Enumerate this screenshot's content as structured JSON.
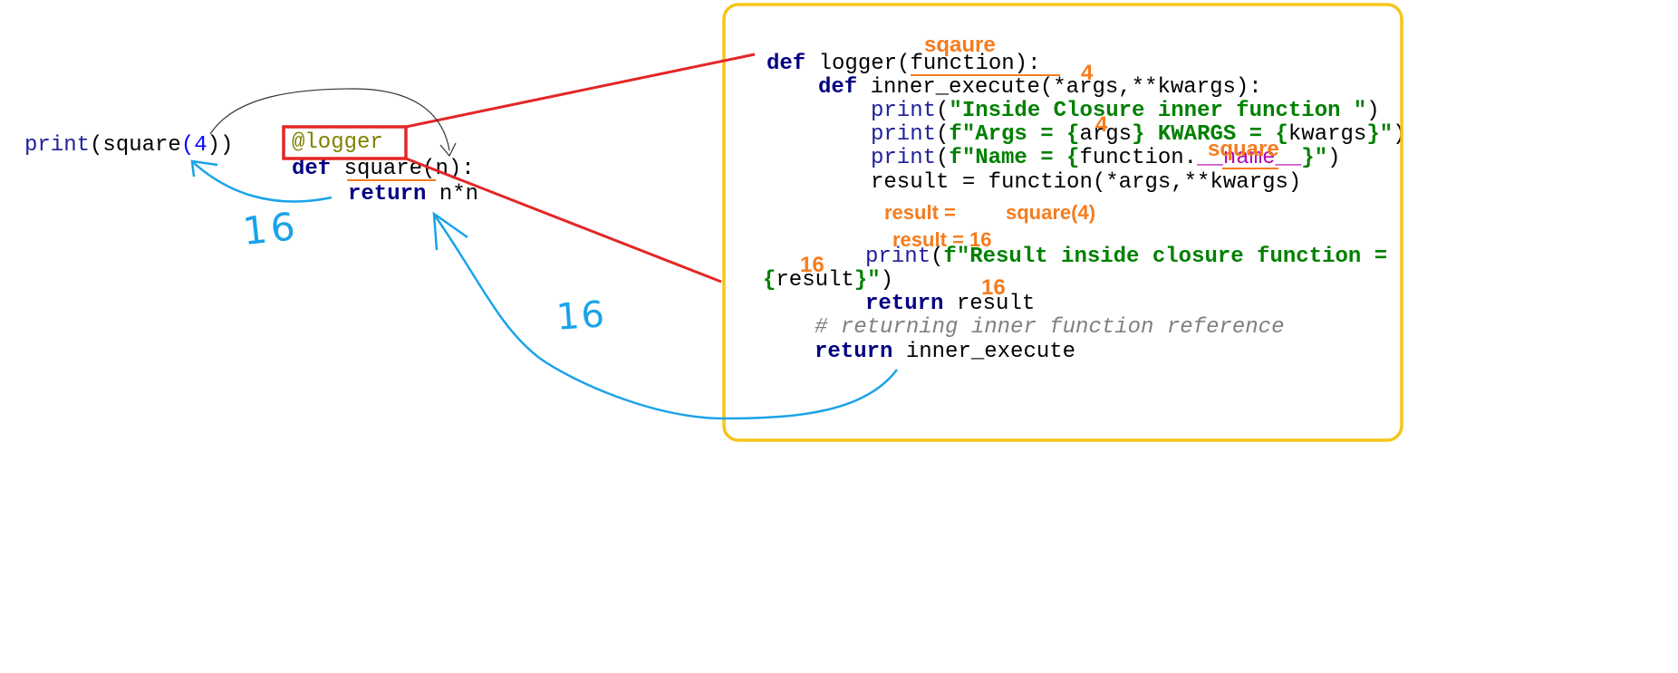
{
  "left_code": {
    "call": {
      "print": "print",
      "open": "(",
      "fn": "square",
      "open2": "(",
      "arg": "4",
      "close": "))"
    },
    "decorator": "@logger",
    "def_kw": "def",
    "def_name": "square",
    "def_args": "(n):",
    "return_kw": "return",
    "return_expr": "n*n"
  },
  "right_code": {
    "l1_kw": "def",
    "l1_rest": "logger(function):",
    "l2_kw": "def",
    "l2_rest": "inner_execute(*args,**kwargs):",
    "l3_print": "print",
    "l3_open": "(",
    "l3_str": "\"Inside Closure inner function \"",
    "l3_close": ")",
    "l4_print": "print",
    "l4_open": "(",
    "l4_s1": "f\"Args = {",
    "l4_v1": "args",
    "l4_s2": "} KWARGS = {",
    "l4_v2": "kwargs",
    "l4_s3": "}\"",
    "l4_close": ")",
    "l5_print": "print",
    "l5_open": "(",
    "l5_s1": "f\"Name = {",
    "l5_v1": "function.",
    "l5_magic": "__name__",
    "l5_s2": "}\"",
    "l5_close": ")",
    "l6": "result = function(*args,**kwargs)",
    "l7_print": "print",
    "l7_open": "(",
    "l7_str": "f\"Result inside closure function = ",
    "l8_s1": "{",
    "l8_v": "result",
    "l8_s2": "}\"",
    "l8_close": ")",
    "l9_kw": "return",
    "l9_rest": "result",
    "l10_comment": "# returning inner function reference",
    "l11_kw": "return",
    "l11_rest": "inner_execute"
  },
  "annotations": {
    "sqaure": "sqaure",
    "four_a": "4",
    "four_b": "4",
    "square_name": "square",
    "result_eq": "result =",
    "square_call": "square(4)",
    "result_16": "result = 16",
    "sixteen_a": "16",
    "sixteen_b": "16"
  },
  "handwritten": {
    "sixteen_left": "16",
    "sixteen_mid": "16"
  },
  "colors": {
    "highlight_box": "#e32626",
    "closure_frame": "#f5c518",
    "flow_arrow": "#1aa3e8",
    "annotation": "#f57c1f"
  }
}
